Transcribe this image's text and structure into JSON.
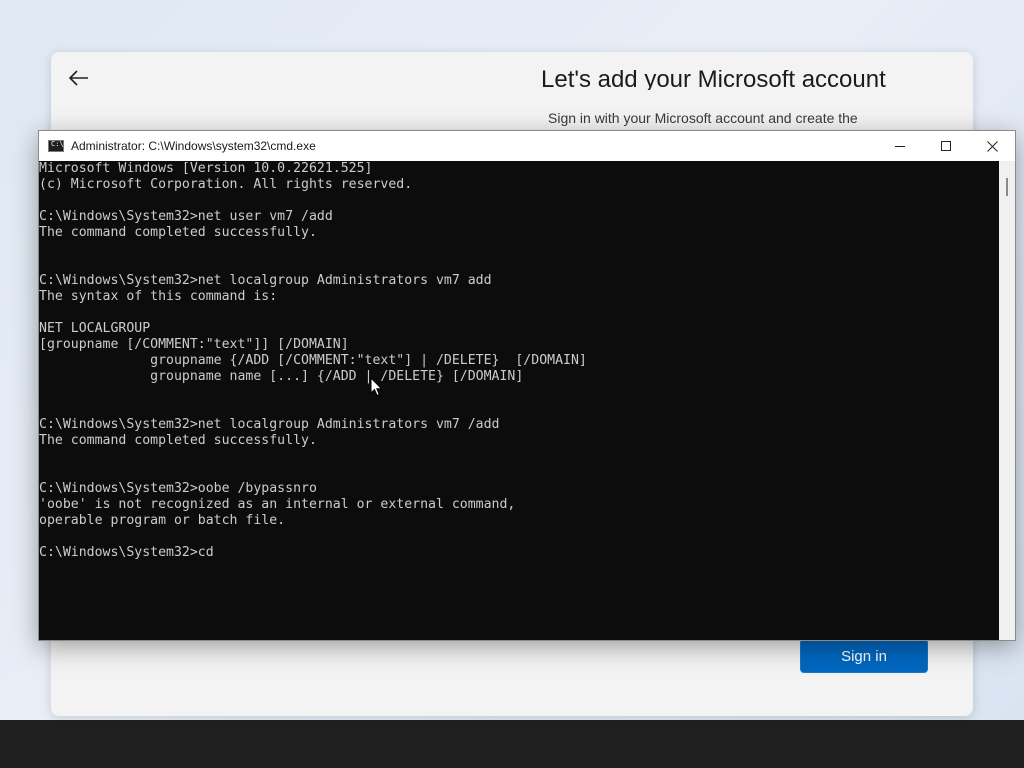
{
  "oobe": {
    "title": "Let's add your Microsoft account",
    "subtitle": "Sign in with your Microsoft account and create the",
    "sign_in_label": "Sign in"
  },
  "cmd": {
    "title": "Administrator: C:\\Windows\\system32\\cmd.exe",
    "lines": [
      "Microsoft Windows [Version 10.0.22621.525]",
      "(c) Microsoft Corporation. All rights reserved.",
      "",
      "C:\\Windows\\System32>net user vm7 /add",
      "The command completed successfully.",
      "",
      "",
      "C:\\Windows\\System32>net localgroup Administrators vm7 add",
      "The syntax of this command is:",
      "",
      "NET LOCALGROUP",
      "[groupname [/COMMENT:\"text\"]] [/DOMAIN]",
      "              groupname {/ADD [/COMMENT:\"text\"] | /DELETE}  [/DOMAIN]",
      "              groupname name [...] {/ADD | /DELETE} [/DOMAIN]",
      "",
      "",
      "C:\\Windows\\System32>net localgroup Administrators vm7 /add",
      "The command completed successfully.",
      "",
      "",
      "C:\\Windows\\System32>oobe /bypassnro",
      "'oobe' is not recognized as an internal or external command,",
      "operable program or batch file.",
      "",
      "C:\\Windows\\System32>cd"
    ]
  },
  "icons": {
    "back": "back-arrow-icon",
    "minimize": "minimize-icon",
    "maximize": "maximize-icon",
    "close": "close-icon",
    "cmd": "cmd-app-icon",
    "cursor": "mouse-pointer-icon"
  },
  "colors": {
    "console_bg": "#0c0c0c",
    "console_text": "#cccccc",
    "accent": "#0067c0"
  }
}
